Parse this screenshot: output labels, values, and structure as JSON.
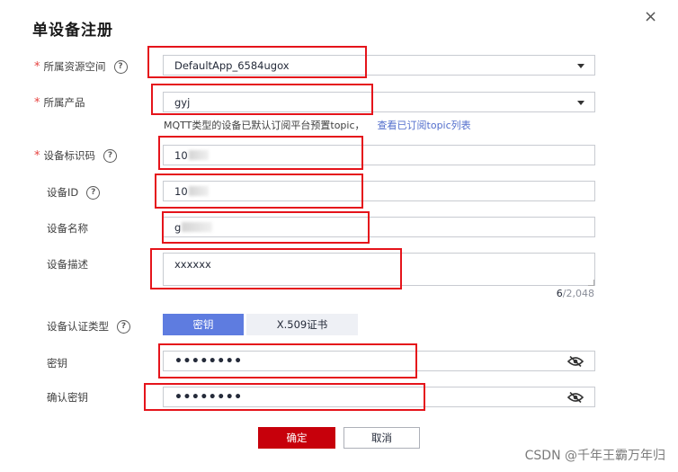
{
  "dialog": {
    "title": "单设备注册",
    "close_symbol": "×"
  },
  "fields": {
    "resource_space": {
      "label": "所属资源空间",
      "required_mark": "*",
      "value": "DefaultApp_6584ugox"
    },
    "product": {
      "label": "所属产品",
      "required_mark": "*",
      "value": "gyj"
    },
    "hint_text": "MQTT类型的设备已默认订阅平台预置topic，",
    "hint_link": "查看已订阅topic列表",
    "node_id": {
      "label": "设备标识码",
      "required_mark": "*",
      "value": "10"
    },
    "device_id": {
      "label": "设备ID",
      "value": "10"
    },
    "device_name": {
      "label": "设备名称",
      "value": "g"
    },
    "description": {
      "label": "设备描述",
      "value": "xxxxxx",
      "counter_current": "6",
      "counter_max": "/2,048"
    },
    "auth_type": {
      "label": "设备认证类型",
      "option_secret": "密钥",
      "option_cert": "X.509证书"
    },
    "secret": {
      "label": "密钥",
      "value": "••••••••"
    },
    "confirm_secret": {
      "label": "确认密钥",
      "value": "••••••••"
    }
  },
  "footer": {
    "ok_label": "确定",
    "cancel_label": "取消"
  },
  "help_symbol": "?",
  "watermark": "CSDN @千年王霸万年归",
  "icons": [
    "close-icon",
    "help-icon",
    "chevron-down-icon",
    "eye-off-icon"
  ],
  "colors": {
    "primary": "#c7000b",
    "auth_selected": "#5e7ce0",
    "link": "#526ecc",
    "required": "#e6413f",
    "annotation": "#e5141b"
  }
}
